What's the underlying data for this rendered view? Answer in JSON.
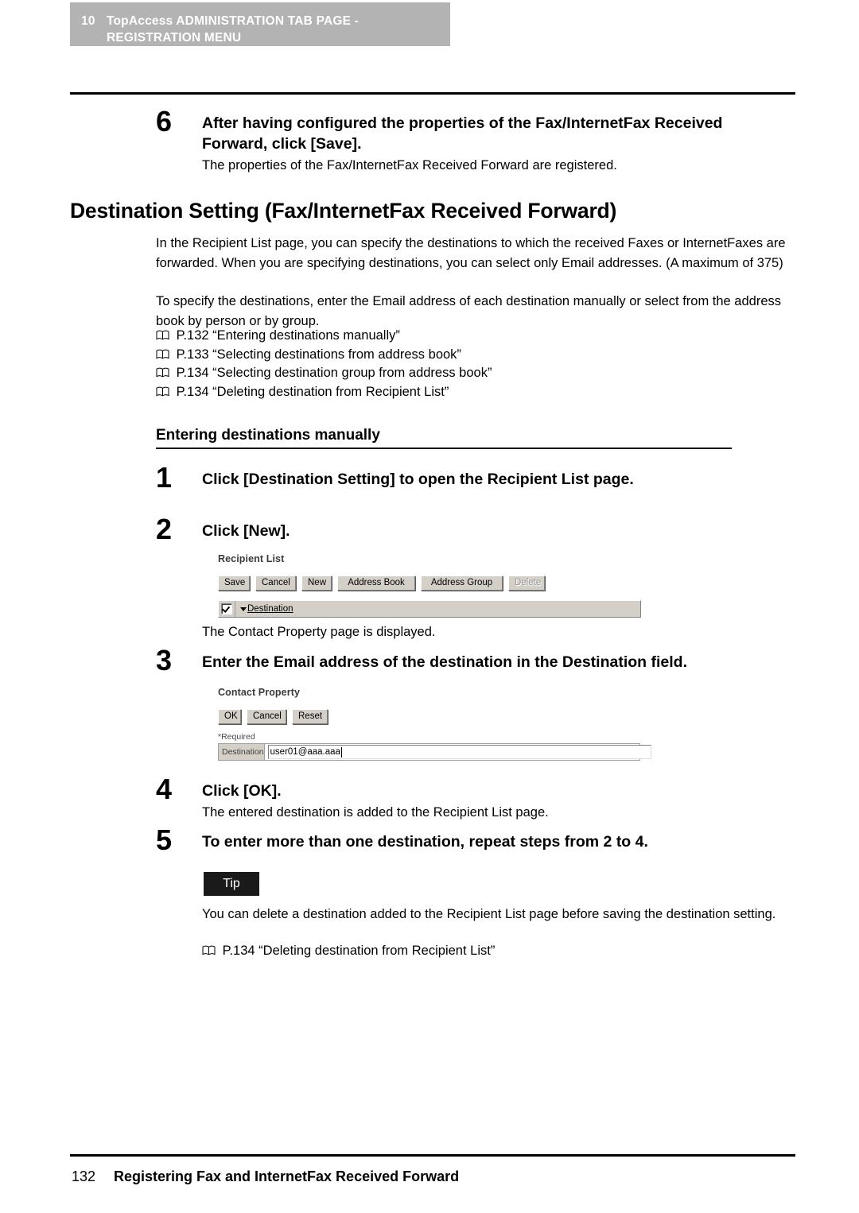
{
  "header": {
    "chapter_number": "10",
    "chapter_title": "TopAccess ADMINISTRATION TAB PAGE - REGISTRATION MENU",
    "banner_color": "#b3b3b3"
  },
  "step6": {
    "number": "6",
    "title": "After having configured the properties of the Fax/InternetFax Received Forward, click [Save].",
    "body": "The properties of the Fax/InternetFax Received Forward are registered."
  },
  "section": {
    "heading": "Destination Setting (Fax/InternetFax Received Forward)",
    "para1": "In the Recipient List page, you can specify the destinations to which the received Faxes or InternetFaxes are forwarded. When you are specifying destinations, you can select only Email addresses. (A maximum of 375)",
    "para2": "To specify the destinations, enter the Email address of each destination manually or select from the address book by person or by group.",
    "xrefs": [
      "P.132 “Entering destinations manually”",
      "P.133 “Selecting destinations from address book”",
      "P.134 “Selecting destination group from address book”",
      "P.134 “Deleting destination from Recipient List”"
    ]
  },
  "subsection": {
    "heading": "Entering destinations manually"
  },
  "step1": {
    "number": "1",
    "title": "Click [Destination Setting] to open the Recipient List page."
  },
  "step2": {
    "number": "2",
    "title": "Click [New].",
    "body": "The Contact Property page is displayed."
  },
  "recipient_list_app": {
    "title": "Recipient List",
    "buttons": [
      {
        "label": "Save",
        "disabled": false
      },
      {
        "label": "Cancel",
        "disabled": false
      },
      {
        "label": "New",
        "disabled": false
      },
      {
        "label": "Address Book",
        "disabled": false
      },
      {
        "label": "Address Group",
        "disabled": false
      },
      {
        "label": "Delete",
        "disabled": true
      }
    ],
    "select_all_checked": "true",
    "column_header": "Destination",
    "sort_direction": "descending"
  },
  "step3": {
    "number": "3",
    "title": "Enter the Email address of the destination in the Destination field."
  },
  "contact_property_app": {
    "title": "Contact Property",
    "buttons": [
      {
        "label": "OK",
        "disabled": false
      },
      {
        "label": "Cancel",
        "disabled": false
      },
      {
        "label": "Reset",
        "disabled": false
      }
    ],
    "required_note": "*Required",
    "field_label": "Destination",
    "field_value": "user01@aaa.aaa"
  },
  "step4": {
    "number": "4",
    "title": "Click [OK].",
    "body": "The entered destination is added to the Recipient List page."
  },
  "step5": {
    "number": "5",
    "title": "To enter more than one destination, repeat steps from 2 to 4."
  },
  "tip": {
    "label": "Tip",
    "body": "You can delete a destination added to the Recipient List page before saving the destination setting.",
    "xref": "P.134 “Deleting destination from Recipient List”"
  },
  "footer": {
    "page_number": "132",
    "title": "Registering Fax and InternetFax Received Forward"
  }
}
